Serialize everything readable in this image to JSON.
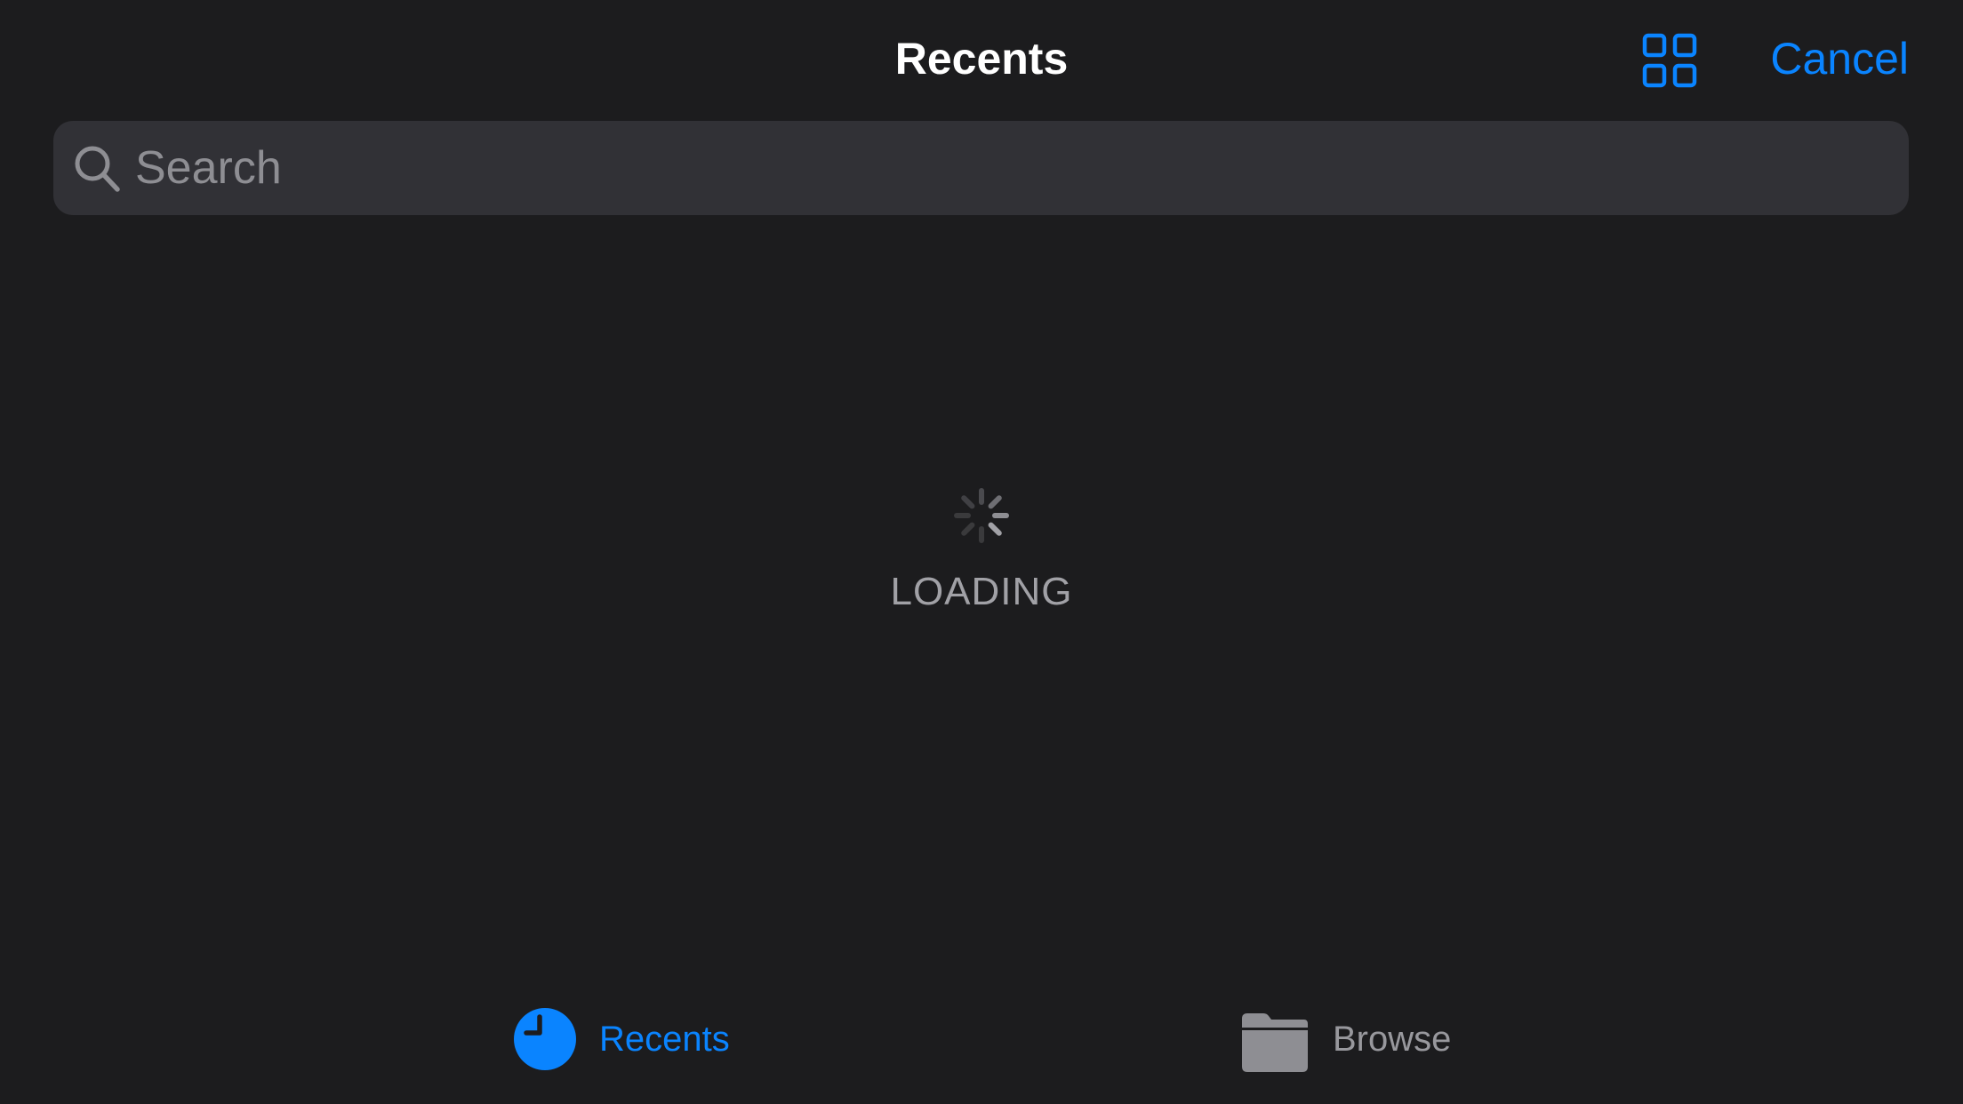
{
  "header": {
    "title": "Recents",
    "grid_icon": "grid-view-icon",
    "cancel_label": "Cancel"
  },
  "search": {
    "placeholder": "Search",
    "value": "",
    "icon": "search-icon"
  },
  "status": {
    "loading_label": "LOADING",
    "icon": "activity-spinner-icon"
  },
  "tabbar": {
    "tabs": [
      {
        "label": "Recents",
        "icon": "clock-icon",
        "selected": true
      },
      {
        "label": "Browse",
        "icon": "folder-icon",
        "selected": false
      }
    ]
  },
  "colors": {
    "background": "#1c1c1e",
    "accent": "#0a84ff",
    "search_field": "#313136",
    "secondary_text": "#8e8e93"
  }
}
